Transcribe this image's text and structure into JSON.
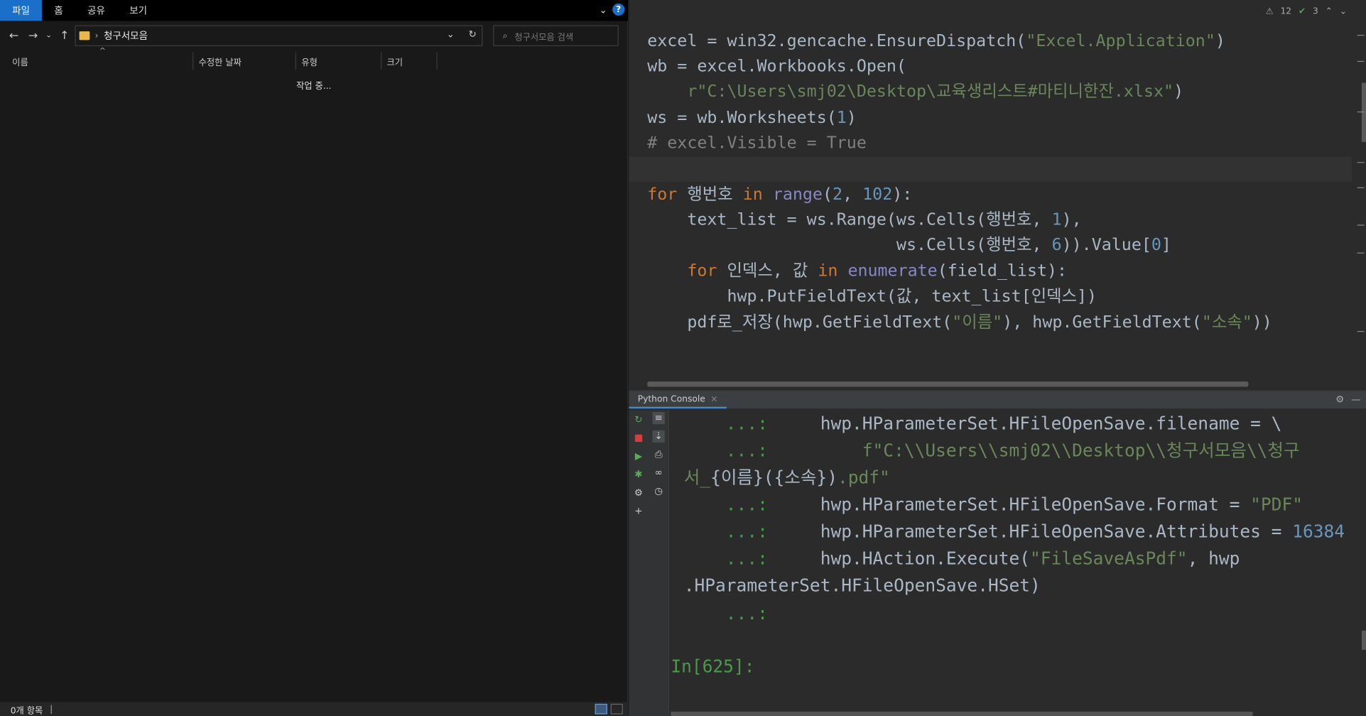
{
  "explorer": {
    "ribbon_tabs": [
      "파일",
      "홈",
      "공유",
      "보기"
    ],
    "path": "청구서모음",
    "search_placeholder": "청구서모음 검색",
    "columns": [
      "이름",
      "수정한 날짜",
      "유형",
      "크기"
    ],
    "loading_text": "작업 중...",
    "status_text": "0개 항목"
  },
  "editor": {
    "inspections": {
      "warnings": "12",
      "ok": "3"
    },
    "lines": [
      "excel = win32.gencache.EnsureDispatch(\"Excel.Application\")",
      "wb = excel.Workbooks.Open(",
      "    r\"C:\\Users\\smj02\\Desktop\\교육생리스트#마티니한잔.xlsx\")",
      "ws = wb.Worksheets(1)",
      "# excel.Visible = True",
      "",
      "for 행번호 in range(2, 102):",
      "    text_list = ws.Range(ws.Cells(행번호, 1),",
      "                         ws.Cells(행번호, 6)).Value[0]",
      "    for 인덱스, 값 in enumerate(field_list):",
      "        hwp.PutFieldText(값, text_list[인덱스])",
      "    pdf로_저장(hwp.GetFieldText(\"이름\"), hwp.GetFieldText(\"소속\"))"
    ]
  },
  "console": {
    "tab_label": "Python Console",
    "lines": [
      "    ...:     hwp.HParameterSet.HFileOpenSave.filename = \\",
      "    ...:         f\"C:\\\\Users\\\\smj02\\\\Desktop\\\\청구서모음\\\\청구",
      "서_{이름}({소속}).pdf\"",
      "    ...:     hwp.HParameterSet.HFileOpenSave.Format = \"PDF\"",
      "    ...:     hwp.HParameterSet.HFileOpenSave.Attributes = 16384",
      "    ...:     hwp.HAction.Execute(\"FileSaveAsPdf\", hwp",
      ".HParameterSet.HFileOpenSave.HSet)",
      "    ...:"
    ],
    "prompt": "In[625]:"
  }
}
